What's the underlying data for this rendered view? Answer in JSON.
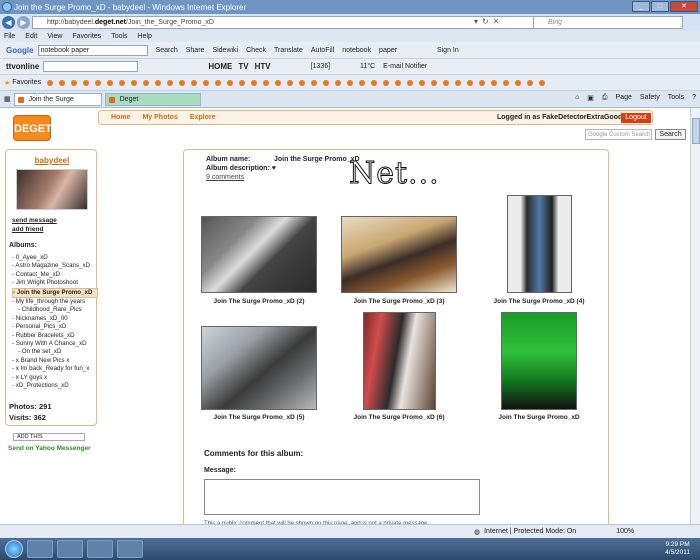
{
  "window": {
    "title": "Join the Surge Promo_xD - babydeel - Windows Internet Explorer"
  },
  "address": {
    "url_prefix": "http://babydeel.",
    "url_domain": "deget.net",
    "url_path": "/Join_the_Surge_Promo_xD",
    "search_placeholder": "Bing"
  },
  "menu": [
    "File",
    "Edit",
    "View",
    "Favorites",
    "Tools",
    "Help"
  ],
  "google_toolbar": {
    "logo": "Google",
    "query": "notebook paper",
    "items": [
      "Search",
      "Share",
      "Sidewiki",
      "Check",
      "Translate",
      "AutoFill",
      "notebook",
      "paper",
      "Sign In"
    ]
  },
  "tv_toolbar": {
    "brand": "ttvonline",
    "items": [
      "HOME",
      "TV",
      "HTV",
      "[1336]",
      "11°C",
      "E-mail Notifier"
    ]
  },
  "favorites": {
    "label": "Favorites"
  },
  "tabs": [
    {
      "label": "Join the Surge Promo_x...",
      "active": true
    },
    {
      "label": "Deget",
      "active": false
    }
  ],
  "ie_commands": [
    "Page",
    "Safety",
    "Tools"
  ],
  "site": {
    "logo": "DEGET",
    "nav": [
      "Home",
      "My Photos",
      "Explore"
    ],
    "logged_in": "Logged in as FakeDetectorExtraGood.",
    "logout": "Logout",
    "search_placeholder": "Google Custom Search",
    "search_button": "Search"
  },
  "sidebar": {
    "username": "babydeel",
    "links": [
      "send message",
      "add friend"
    ],
    "albums_label": "Albums:",
    "albums": [
      "- 0_Ayee_xD",
      "- Astro Magazine_Scans_xD",
      "- Contact_Me_xD",
      "- Jim Wright Photoshoot",
      "- Join the Surge Promo_xD",
      "- My life_through the years",
      "  - Childhood_Rare_Pics",
      "- Nicknames_xD_00",
      "- Personal_Pics_xD",
      "- Rubber Bracelets_xD",
      "- Sonny With A Chance_xD",
      "  - On the set_xD",
      "- x Brand New Pics x",
      "- x Im back_Ready for fun_x",
      "- x LY guys x",
      "- xD_Protections_xD"
    ],
    "selected_index": 4,
    "photos": "Photos: 291",
    "visits": "Visits: 362",
    "addthis": "ADD THIS",
    "yahoo": "Send on Yahoo Messenger"
  },
  "album": {
    "name_label": "Album name:",
    "name": "Join the Surge Promo_xD",
    "desc_label": "Album description: ♥",
    "comments_link": "9 comments",
    "overlay_text": "Net...",
    "photos": [
      {
        "title": "Join The Surge Promo_xD (2)"
      },
      {
        "title": "Join The Surge Promo_xD (3)"
      },
      {
        "title": "Join The Surge Promo_xD (4)"
      },
      {
        "title": "Join The Surge Promo_xD (5)"
      },
      {
        "title": "Join The Surge Promo_xD (6)"
      },
      {
        "title": "Join The Surge Promo_xD"
      }
    ],
    "comments_heading": "Comments for this album:",
    "message_label": "Message:",
    "note": "This a public comment that will be shown on this page, and is not a private message."
  },
  "status": {
    "zone": "Internet | Protected Mode: On",
    "zoom": "100%"
  },
  "taskbar": {
    "time": "9:29 PM",
    "date": "4/5/2011"
  }
}
